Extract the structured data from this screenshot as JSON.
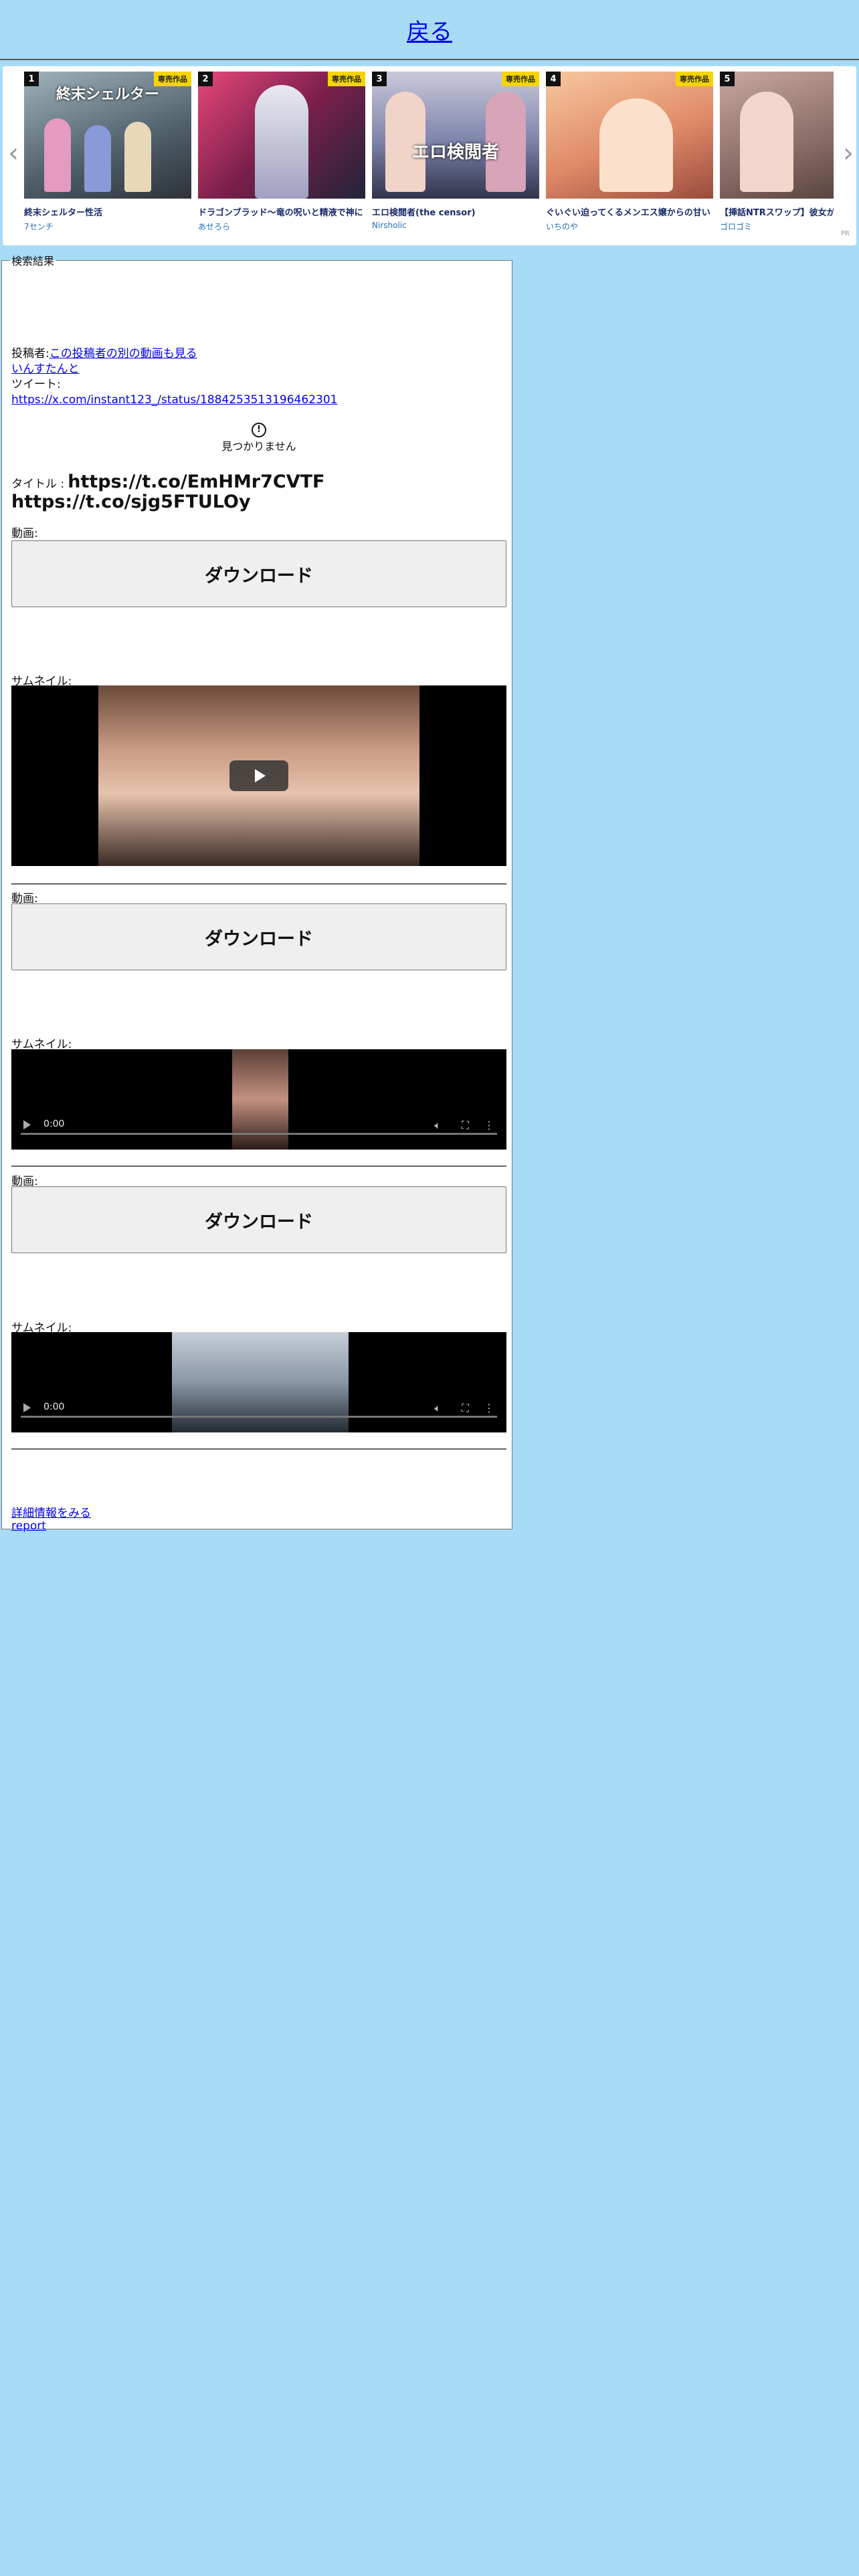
{
  "header": {
    "back_label": "戻る"
  },
  "carousel": {
    "prev_arrow": "‹",
    "next_arrow": "›",
    "pr_label": "PR",
    "items": [
      {
        "rank": "1",
        "badge": "専売作品",
        "title": "終末シェルター性活",
        "author": "7センチ",
        "thumb_text": "終末シェルター",
        "color": "#6b7f8a"
      },
      {
        "rank": "2",
        "badge": "専売作品",
        "title": "ドラゴンブラッド〜竜の呪いと精液で神に",
        "author": "あせろら",
        "thumb_text": "",
        "color": "#c64a7a"
      },
      {
        "rank": "3",
        "badge": "専売作品",
        "title": "エロ検閲者(the censor)",
        "author": "Nirsholic",
        "thumb_text": "エロ検閲者",
        "color": "#7a7fa8"
      },
      {
        "rank": "4",
        "badge": "専売作品",
        "title": "ぐいぐい迫ってくるメンエス嬢からの甘い",
        "author": "いちのや",
        "thumb_text": "",
        "color": "#e0a474"
      },
      {
        "rank": "5",
        "badge": "",
        "title": "【挿話NTRスワップ】彼女が",
        "author": "ゴロゴミ",
        "thumb_text": "",
        "color": "#8a6c66"
      }
    ]
  },
  "result": {
    "legend": "検索結果",
    "poster_label": "投稿者:",
    "poster_other_link": "この投稿者の別の動画も見る",
    "poster_name": "いんすたんと",
    "tweet_label": "ツイート:",
    "tweet_url": "https://x.com/instant123_/status/1884253513196462301",
    "not_found_icon": "!",
    "not_found_text": "見つかりません",
    "title_label": "タイトル :",
    "title_value": "https://t.co/EmHMr7CVTF https://t.co/sjg5FTULOy",
    "more_link": "詳細情報をみる",
    "report_link": "report"
  },
  "videos": [
    {
      "video_label": "動画:",
      "download_label": "ダウンロード",
      "thumb_label": "サムネイル:",
      "time": "",
      "player": "preview"
    },
    {
      "video_label": "動画:",
      "download_label": "ダウンロード",
      "thumb_label": "サムネイル:",
      "time": "0:00",
      "player": "controls"
    },
    {
      "video_label": "動画:",
      "download_label": "ダウンロード",
      "thumb_label": "サムネイル:",
      "time": "0:00",
      "player": "controls"
    }
  ],
  "colors": {
    "page_bg": "#a8dbf5",
    "link": "#0000ee",
    "badge": "#f5d400"
  }
}
